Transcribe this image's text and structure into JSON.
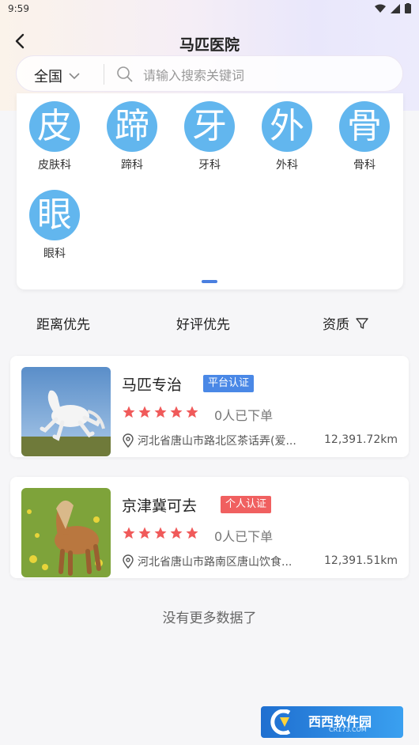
{
  "status_bar": {
    "time": "9:59"
  },
  "nav": {
    "title": "马匹医院"
  },
  "search": {
    "region": "全国",
    "placeholder": "请输入搜索关键词"
  },
  "categories": [
    {
      "glyph": "皮",
      "label": "皮肤科"
    },
    {
      "glyph": "蹄",
      "label": "蹄科"
    },
    {
      "glyph": "牙",
      "label": "牙科"
    },
    {
      "glyph": "外",
      "label": "外科"
    },
    {
      "glyph": "骨",
      "label": "骨科"
    },
    {
      "glyph": "眼",
      "label": "眼科"
    }
  ],
  "sort": {
    "distance": "距离优先",
    "rating": "好评优先",
    "qualification": "资质"
  },
  "listings": [
    {
      "name": "马匹专治",
      "badge": "平台认证",
      "badge_color": "#4a88e6",
      "rating": 5,
      "orders": "0人已下单",
      "address": "河北省唐山市路北区茶话弄(爱...",
      "distance": "12,391.72km"
    },
    {
      "name": "京津冀可去",
      "badge": "个人认证",
      "badge_color": "#f06060",
      "rating": 5,
      "orders": "0人已下单",
      "address": "河北省唐山市路南区唐山饮食...",
      "distance": "12,391.51km"
    }
  ],
  "footer": {
    "no_more": "没有更多数据了"
  },
  "watermark": {
    "text": "西西软件园",
    "sub": "CR173.COM"
  },
  "colors": {
    "accent": "#4a7fe0",
    "category_circle": "#62b6ee",
    "star": "#f05a5a"
  }
}
